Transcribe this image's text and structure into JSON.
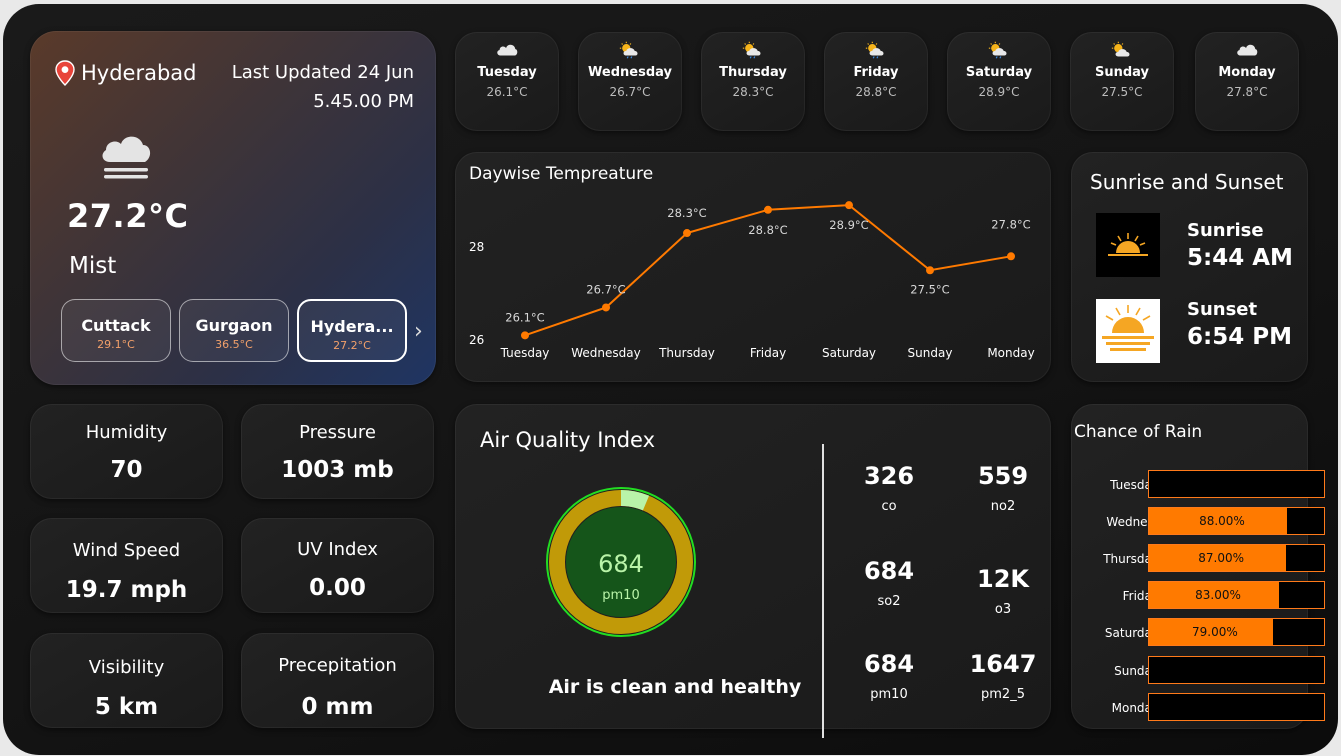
{
  "location": {
    "city": "Hyderabad",
    "updated_line1": "Last Updated 24 Jun",
    "updated_line2": "5.45.00 PM",
    "temperature": "27.2°C",
    "condition": "Mist",
    "condition_icon": "cloud-mist-icon"
  },
  "cities": [
    {
      "name": "Cuttack",
      "temp": "29.1°C"
    },
    {
      "name": "Gurgaon",
      "temp": "36.5°C"
    },
    {
      "name": "Hydera...",
      "temp": "27.2°C"
    }
  ],
  "forecast": [
    {
      "day": "Tuesday",
      "temp": "26.1°C",
      "icon": "cloud-icon"
    },
    {
      "day": "Wednesday",
      "temp": "26.7°C",
      "icon": "sun-rain-icon"
    },
    {
      "day": "Thursday",
      "temp": "28.3°C",
      "icon": "sun-rain-icon"
    },
    {
      "day": "Friday",
      "temp": "28.8°C",
      "icon": "sun-rain-icon"
    },
    {
      "day": "Saturday",
      "temp": "28.9°C",
      "icon": "sun-rain-icon"
    },
    {
      "day": "Sunday",
      "temp": "27.5°C",
      "icon": "sun-cloud-icon"
    },
    {
      "day": "Monday",
      "temp": "27.8°C",
      "icon": "cloud-icon"
    }
  ],
  "chart_data": {
    "type": "line",
    "title": "Daywise Tempreature",
    "categories": [
      "Tuesday",
      "Wednesday",
      "Thursday",
      "Friday",
      "Saturday",
      "Sunday",
      "Monday"
    ],
    "values": [
      26.1,
      26.7,
      28.3,
      28.8,
      28.9,
      27.5,
      27.8
    ],
    "data_labels": [
      "26.1°C",
      "26.7°C",
      "28.3°C",
      "28.8°C",
      "28.9°C",
      "27.5°C",
      "27.8°C"
    ],
    "y_ticks": [
      "26",
      "28"
    ],
    "ylim": [
      25.9,
      29.2
    ],
    "color": "#ff7a00",
    "grid": false
  },
  "sun": {
    "title": "Sunrise and Sunset",
    "sunrise_label": "Sunrise",
    "sunrise_time": "5:44 AM",
    "sunset_label": "Sunset",
    "sunset_time": "6:54 PM"
  },
  "stats": [
    {
      "label": "Humidity",
      "value": "70"
    },
    {
      "label": "Pressure",
      "value": "1003 mb"
    },
    {
      "label": "Wind Speed",
      "value": "19.7 mph"
    },
    {
      "label": "UV Index",
      "value": "0.00"
    },
    {
      "label": "Visibility",
      "value": "5 km"
    },
    {
      "label": "Precepitation",
      "value": "0 mm"
    }
  ],
  "aqi": {
    "title": "Air Quality Index",
    "gauge_value": "684",
    "gauge_label": "pm10",
    "message": "Air is clean and healthy",
    "pollutants": [
      {
        "value": "326",
        "name": "co"
      },
      {
        "value": "559",
        "name": "no2"
      },
      {
        "value": "684",
        "name": "so2"
      },
      {
        "value": "12K",
        "name": "o3"
      },
      {
        "value": "684",
        "name": "pm10"
      },
      {
        "value": "1647",
        "name": "pm2_5"
      }
    ]
  },
  "rain": {
    "title": "Chance of Rain",
    "rows": [
      {
        "day": "Tuesday",
        "pct": 0,
        "label": ""
      },
      {
        "day": "Wedne...",
        "pct": 88,
        "label": "88.00%"
      },
      {
        "day": "Thursday",
        "pct": 87,
        "label": "87.00%"
      },
      {
        "day": "Friday",
        "pct": 83,
        "label": "83.00%"
      },
      {
        "day": "Saturday",
        "pct": 79,
        "label": "79.00%"
      },
      {
        "day": "Sunday",
        "pct": 0,
        "label": ""
      },
      {
        "day": "Monday",
        "pct": 0,
        "label": ""
      }
    ]
  }
}
